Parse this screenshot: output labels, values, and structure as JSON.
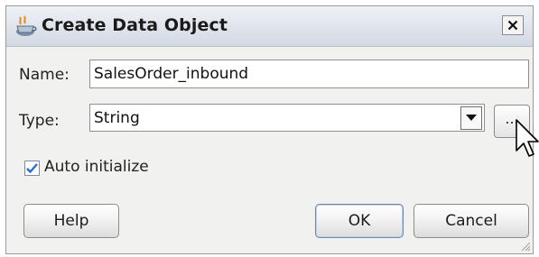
{
  "window": {
    "title": "Create Data Object",
    "close_label": "✕"
  },
  "form": {
    "name_label": "Name:",
    "name_value": "SalesOrder_inbound",
    "type_label": "Type:",
    "type_value": "String",
    "browse_label": "...",
    "auto_initialize_label": "Auto initialize",
    "auto_initialize_checked": true
  },
  "buttons": {
    "help": "Help",
    "ok": "OK",
    "cancel": "Cancel"
  },
  "colors": {
    "dialog_bg": "#f1f1ef",
    "title_gradient_top": "#eef1f6",
    "checkmark": "#2a6bd1"
  },
  "icons": {
    "app": "coffee-cup-icon",
    "close": "close-icon",
    "dropdown": "triangle-down-icon",
    "resize": "resize-grip-icon",
    "pointer": "mouse-pointer-icon"
  }
}
